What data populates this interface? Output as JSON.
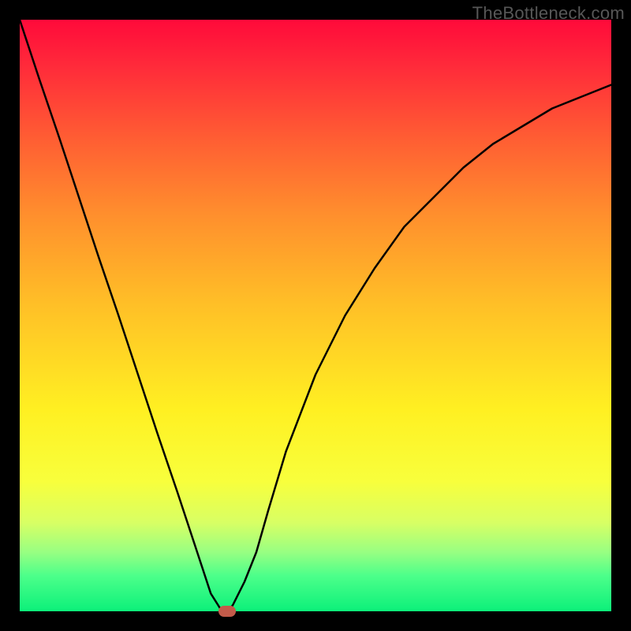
{
  "watermark": "TheBottleneck.com",
  "chart_data": {
    "type": "line",
    "title": "",
    "xlabel": "",
    "ylabel": "",
    "xlim": [
      0,
      1
    ],
    "ylim": [
      0,
      1
    ],
    "series": [
      {
        "name": "curve",
        "x": [
          0.0,
          0.033,
          0.067,
          0.1,
          0.133,
          0.167,
          0.2,
          0.233,
          0.267,
          0.3,
          0.323,
          0.34,
          0.35,
          0.36,
          0.38,
          0.4,
          0.42,
          0.45,
          0.5,
          0.55,
          0.6,
          0.65,
          0.7,
          0.75,
          0.8,
          0.85,
          0.9,
          0.95,
          1.0
        ],
        "y": [
          1.0,
          0.9,
          0.8,
          0.7,
          0.6,
          0.5,
          0.4,
          0.3,
          0.2,
          0.1,
          0.03,
          0.003,
          0.0,
          0.01,
          0.05,
          0.1,
          0.17,
          0.27,
          0.4,
          0.5,
          0.58,
          0.65,
          0.7,
          0.75,
          0.79,
          0.82,
          0.85,
          0.87,
          0.89
        ]
      }
    ],
    "marker": {
      "x": 0.35,
      "y": 0.0
    },
    "grid": false,
    "legend": false
  }
}
